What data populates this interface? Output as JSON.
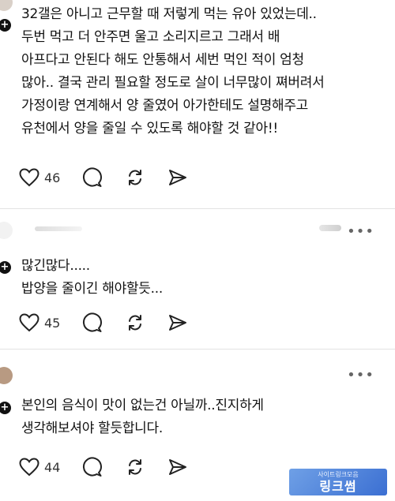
{
  "posts": [
    {
      "text": "32갤은 아니고 근무할 때 저렇게 먹는 유아 있었는데..\n두번 먹고 더 안주면 울고 소리지르고 그래서 배\n아프다고 안된다 해도 안통해서 세번 먹인 적이 엄청\n많아.. 결국 관리 필요할 정도로 살이 너무많이 쪄버려서\n가정이랑 연계해서 양 줄였어 아가한테도 설명해주고\n유천에서 양을 줄일 수 있도록 해야할 것 같아!!",
      "likes": "46"
    },
    {
      "text": "많긴많다.....\n밥양을 줄이긴 해야할듯...",
      "likes": "45"
    },
    {
      "text": "본인의 음식이 맛이 없는건 아닐까..진지하게\n생각해보셔야 할듯합니다.",
      "likes": "44"
    }
  ],
  "icons": {
    "like": "heart-icon",
    "comment": "comment-bubble-icon",
    "repost": "repost-icon",
    "share": "send-icon",
    "more": "more-dots-icon",
    "follow": "plus-icon"
  },
  "more_label": "•••",
  "plus_label": "+",
  "watermark": {
    "small": "사이트링크모음",
    "big": "링크썸"
  }
}
